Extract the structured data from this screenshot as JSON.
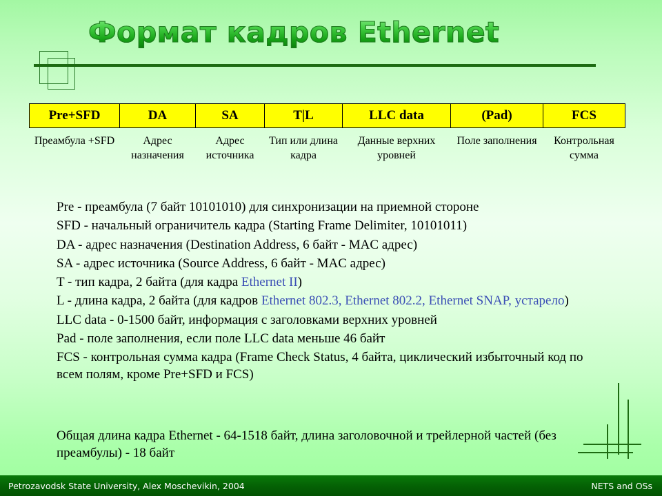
{
  "slide": {
    "title": "Формат кадров Ethernet"
  },
  "frame_table": {
    "headers": [
      "Pre+SFD",
      "DA",
      "SA",
      "T|L",
      "LLC data",
      "(Pad)",
      "FCS"
    ],
    "descriptions": [
      "Преамбула +SFD",
      "Адрес назначения",
      "Адрес источника",
      "Тип или длина кадра",
      "Данные верхних уровней",
      "Поле заполнения",
      "Контрольная сумма"
    ]
  },
  "body": {
    "lines": [
      "Pre - преамбула (7 байт 10101010) для синхронизации на приемной стороне",
      "SFD - начальный ограничитель кадра (Starting Frame Delimiter, 10101011)",
      "DA - адрес назначения (Destination Address, 6 байт - MAC адрес)",
      "SA - адрес источника (Source Address, 6 байт - MAC адрес)",
      "LLC data - 0-1500 байт, информация с заголовками верхних уровней",
      "Pad - поле заполнения, если поле LLC data меньше 46 байт",
      "FCS - контрольная сумма кадра (Frame Check Status, 4 байта, циклический избыточный код по всем полям, кроме Pre+SFD и FCS)"
    ],
    "type_line": {
      "before": "T - тип кадра, 2 байта (для кадра ",
      "link": "Ethernet II",
      "after": ")"
    },
    "length_line": {
      "before": "L - длина кадра, 2 байта (для кадров ",
      "link": "Ethernet 802.3, Ethernet 802.2, Ethernet SNAP, устарело",
      "after": ")"
    },
    "summary": "Общая длина кадра Ethernet - 64-1518 байт, длина заголовочной и трейлерной частей (без преамбулы) - 18 байт"
  },
  "footer": {
    "left": "Petrozavodsk State University, Alex Moschevikin, 2004",
    "right": "NETS and OSs"
  },
  "colors": {
    "header_fill": "#ffff00",
    "link": "#3b4fb5",
    "rule": "#1d6b12",
    "footer_bg": "#046004"
  }
}
